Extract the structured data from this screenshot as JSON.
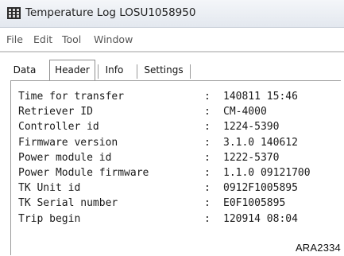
{
  "window": {
    "title": "Temperature Log LOSU1058950"
  },
  "menu": {
    "items": [
      {
        "label": "File"
      },
      {
        "label": "Edit"
      },
      {
        "label": "Tool"
      },
      {
        "label": "Window"
      }
    ]
  },
  "tabs": {
    "items": [
      {
        "label": "Data",
        "active": false
      },
      {
        "label": "Header",
        "active": true
      },
      {
        "label": "Info",
        "active": false
      },
      {
        "label": "Settings",
        "active": false
      }
    ]
  },
  "header_table": {
    "rows": [
      {
        "label": "Time for transfer",
        "separator": ":",
        "value": "140811 15:46"
      },
      {
        "label": "Retriever ID",
        "separator": ":",
        "value": "CM-4000"
      },
      {
        "label": "Controller id",
        "separator": ":",
        "value": "1224-5390"
      },
      {
        "label": "Firmware version",
        "separator": ":",
        "value": "3.1.0 140612"
      },
      {
        "label": "Power module id",
        "separator": ":",
        "value": "1222-5370"
      },
      {
        "label": "Power Module firmware",
        "separator": ":",
        "value": "1.1.0 09121700"
      },
      {
        "label": "TK Unit id",
        "separator": ":",
        "value": "0912F1005895"
      },
      {
        "label": "TK Serial number",
        "separator": ":",
        "value": "E0F1005895"
      },
      {
        "label": "Trip begin",
        "separator": ":",
        "value": "120914 08:04"
      }
    ]
  },
  "figure_code": "ARA2334",
  "icons": {
    "app": "thermometer-grid-app-icon"
  }
}
